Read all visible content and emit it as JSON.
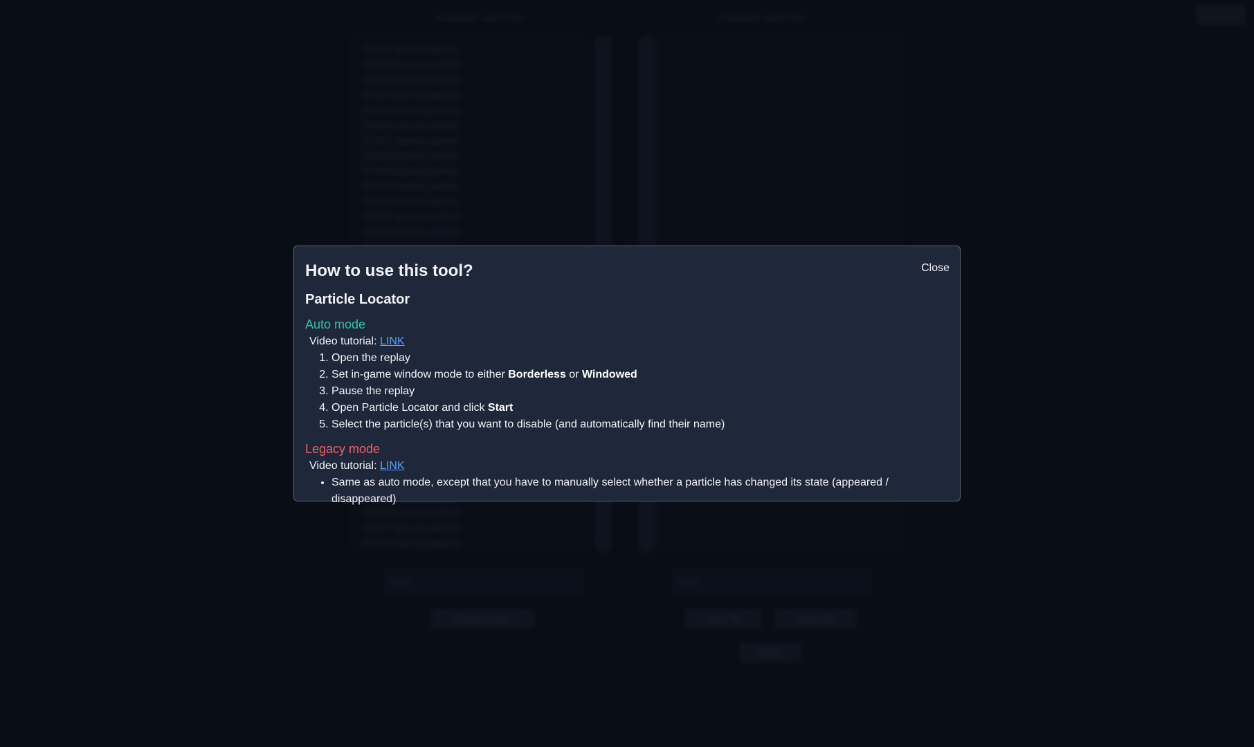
{
  "background": {
    "left_title": "Available particles",
    "right_title": "Disabled particles",
    "left_list": [
      "FX001 blurred particle",
      "FX002 blurred particle",
      "FX003 blurred particle",
      "FX004 blurred particle",
      "FX005 blurred particle",
      "FX006 blurred particle",
      "FX007 blurred particle",
      "FX008 blurred particle",
      "FX009 blurred particle",
      "FX010 blurred particle",
      "FX011 blurred particle",
      "FX012 blurred particle",
      "FX013 blurred particle",
      "FX014 blurred particle"
    ],
    "left_list_bottom": [
      "FX025 blurred particle",
      "FX026 blurred particle",
      "FX027 blurred particle",
      "FX028 blurred particle"
    ],
    "left_filter_placeholder": "Filter",
    "right_filter_placeholder": "Filter",
    "left_button": "Particle Locator",
    "right_button_1": "Import file",
    "right_button_2": "Export file",
    "right_button_3": "Apply"
  },
  "modal": {
    "title": "How to use this tool?",
    "close_label": "Close",
    "section_title": "Particle Locator",
    "auto": {
      "title": "Auto mode",
      "tutorial_label": "Video tutorial:",
      "tutorial_link": "LINK",
      "steps": [
        {
          "text": "Open the replay"
        },
        {
          "pre": "Set in-game window mode to either ",
          "b1": "Borderless",
          "mid": " or ",
          "b2": "Windowed"
        },
        {
          "text": "Pause the replay"
        },
        {
          "pre": "Open Particle Locator and click ",
          "b1": "Start"
        },
        {
          "text": "Select the particle(s) that you want to disable (and automatically find their name)"
        }
      ]
    },
    "legacy": {
      "title": "Legacy mode",
      "tutorial_label": "Video tutorial:",
      "tutorial_link": "LINK",
      "bullets": [
        "Same as auto mode, except that you have to manually select whether a particle has changed its state (appeared / disappeared)"
      ]
    }
  },
  "colors": {
    "modal_bg": "#1f283a",
    "auto_accent": "#2ec4b0",
    "legacy_accent": "#ec5f67",
    "link": "#5aa0ff"
  }
}
